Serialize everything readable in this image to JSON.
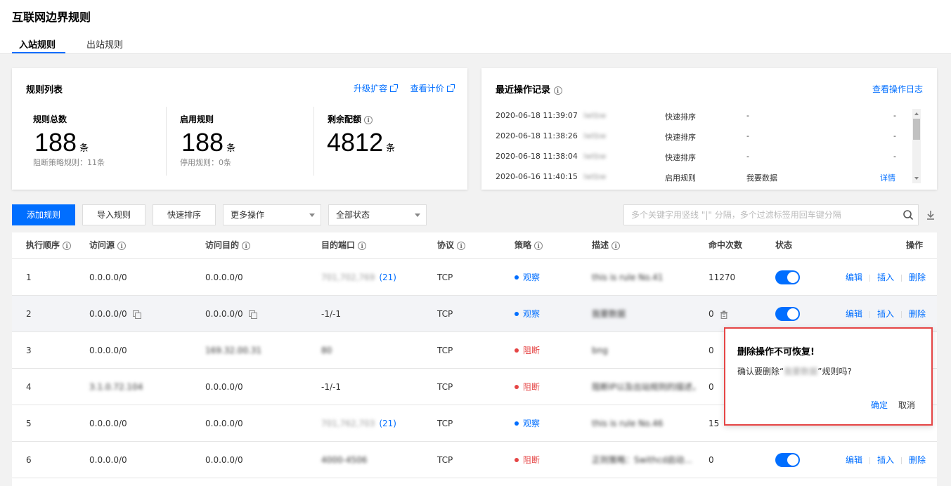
{
  "page": {
    "title": "互联网边界规则"
  },
  "tabs": [
    {
      "label": "入站规则",
      "active": true
    },
    {
      "label": "出站规则",
      "active": false
    }
  ],
  "rules_card": {
    "title": "规则列表",
    "upgrade_link": "升级扩容",
    "pricing_link": "查看计价",
    "stats": [
      {
        "label": "规则总数",
        "value": "188",
        "unit": "条",
        "sub": "阻断策略规则：11条"
      },
      {
        "label": "启用规则",
        "value": "188",
        "unit": "条",
        "sub": "停用规则：0条"
      },
      {
        "label": "剩余配额",
        "value": "4812",
        "unit": "条",
        "sub": ""
      }
    ]
  },
  "ops_card": {
    "title": "最近操作记录",
    "log_link": "查看操作日志",
    "rows": [
      {
        "time": "2020-06-18 11:39:07",
        "user": "lwtbw",
        "action": "快速排序",
        "target": "-",
        "detail": "-"
      },
      {
        "time": "2020-06-18 11:38:26",
        "user": "lwtbw",
        "action": "快速排序",
        "target": "-",
        "detail": "-"
      },
      {
        "time": "2020-06-18 11:38:04",
        "user": "lwtbw",
        "action": "快速排序",
        "target": "-",
        "detail": "-"
      },
      {
        "time": "2020-06-16 11:40:15",
        "user": "lwtbw",
        "action": "启用规则",
        "target": "我要数据",
        "detail": "详情"
      }
    ]
  },
  "toolbar": {
    "add_label": "添加规则",
    "import_label": "导入规则",
    "sort_label": "快速排序",
    "more_label": "更多操作",
    "status_label": "全部状态",
    "search_placeholder": "多个关键字用竖线 \"|\" 分隔，多个过滤标签用回车键分隔"
  },
  "table": {
    "headers": {
      "order": "执行顺序",
      "source": "访问源",
      "dest": "访问目的",
      "port": "目的端口",
      "protocol": "协议",
      "strategy": "策略",
      "desc": "描述",
      "hits": "命中次数",
      "status": "状态",
      "ops": "操作"
    },
    "rows": [
      {
        "order": "1",
        "source": "0.0.0.0/0",
        "dest": "0.0.0.0/0",
        "port": "701,702,769",
        "port_count": "(21)",
        "protocol": "TCP",
        "strategy": "观察",
        "strategy_type": "observe",
        "desc": "this is rule No.41",
        "hits": "11270"
      },
      {
        "order": "2",
        "source": "0.0.0.0/0",
        "dest": "0.0.0.0/0",
        "port": "-1/-1",
        "port_count": "",
        "protocol": "TCP",
        "strategy": "观察",
        "strategy_type": "observe",
        "desc": "我要数据",
        "hits": "0"
      },
      {
        "order": "3",
        "source": "0.0.0.0/0",
        "dest": "169.32.00.31",
        "port": "80",
        "port_count": "",
        "protocol": "TCP",
        "strategy": "阻断",
        "strategy_type": "block",
        "desc": "bng",
        "hits": "0"
      },
      {
        "order": "4",
        "source": "3.1.0.72.104",
        "dest": "0.0.0.0/0",
        "port": "-1/-1",
        "port_count": "",
        "protocol": "TCP",
        "strategy": "阻断",
        "strategy_type": "block",
        "desc": "阻断IP以及出站规则的描述，随...",
        "hits": "0"
      },
      {
        "order": "5",
        "source": "0.0.0.0/0",
        "dest": "0.0.0.0/0",
        "port": "701,762,703",
        "port_count": "(21)",
        "protocol": "TCP",
        "strategy": "观察",
        "strategy_type": "observe",
        "desc": "this is rule No.46",
        "hits": "15"
      },
      {
        "order": "6",
        "source": "0.0.0.0/0",
        "dest": "0.0.0.0/0",
        "port": "4000-4506",
        "port_count": "",
        "protocol": "TCP",
        "strategy": "阻断",
        "strategy_type": "block",
        "desc": "正则策略：Swithcd启动...",
        "hits": "0"
      }
    ],
    "op_edit": "编辑",
    "op_insert": "插入",
    "op_delete": "删除"
  },
  "popover": {
    "title": "删除操作不可恢复!",
    "body_prefix": "确认要删除“",
    "body_name": "我要数据",
    "body_suffix": "”规则吗?",
    "confirm": "确定",
    "cancel": "取消"
  },
  "colors": {
    "primary": "#006eff",
    "danger": "#e54545"
  }
}
